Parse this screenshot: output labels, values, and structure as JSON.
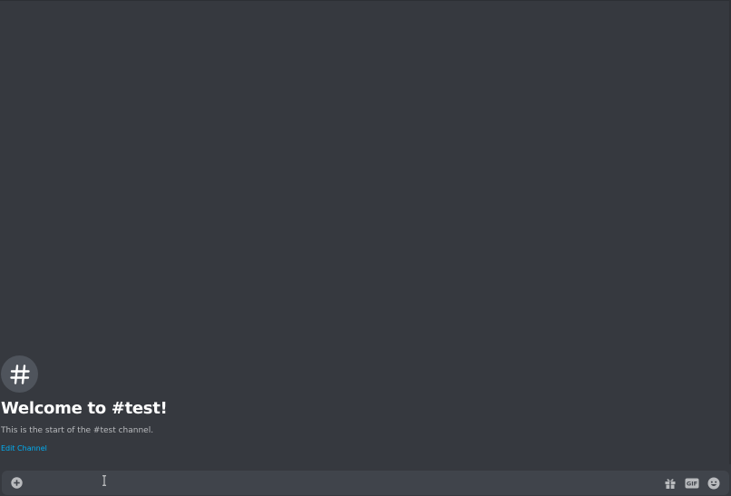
{
  "welcome": {
    "avatar_glyph": "#",
    "title": "Welcome to #test!",
    "subtitle": "This is the start of the #test channel.",
    "edit_link": "Edit Channel"
  },
  "composer": {
    "input_value": "",
    "icons": {
      "attach": "plus-circle-icon",
      "gift": "gift-icon",
      "gif": "gif-icon",
      "emoji": "smiley-icon"
    },
    "gif_label": "GIF"
  },
  "colors": {
    "background": "#36393f",
    "composer": "#40444b",
    "link": "#00aff4",
    "icon": "#b9bbbe"
  }
}
